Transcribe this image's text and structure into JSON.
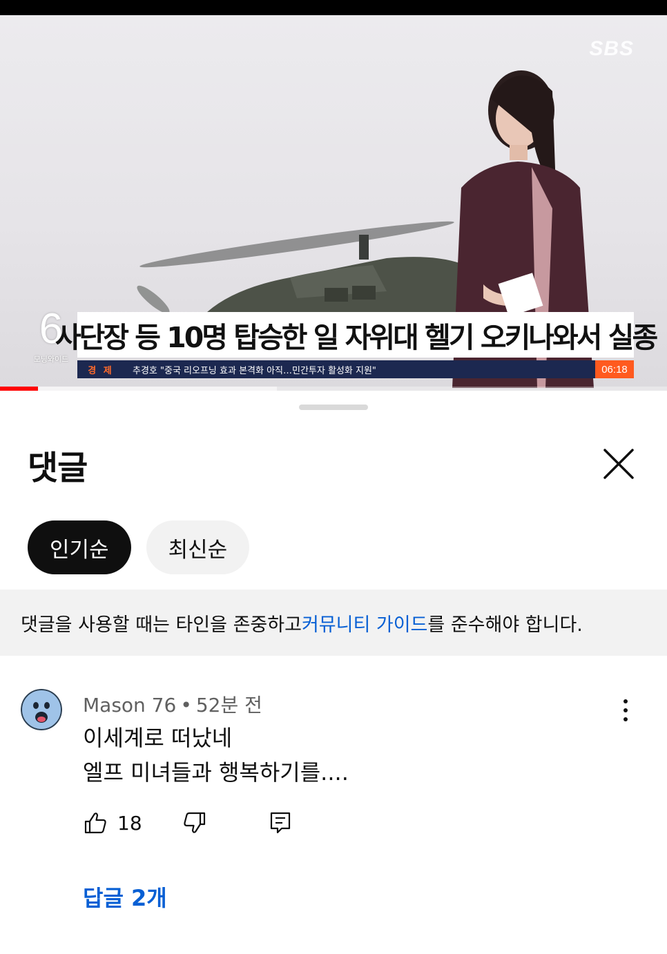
{
  "video": {
    "channel_logo": "SBS",
    "channel_number": "6",
    "program_label": "모닝와이드",
    "headline": "사단장 등 10명 탑승한 일 자위대 헬기 오키나와서 실종",
    "ticker_category": "경 제",
    "ticker_text": "추경호 \"중국 리오프닝 효과 본격화 아직…민간투자 활성화 지원\"",
    "broadcast_time": "06:18",
    "progress_played_fraction": 0.057,
    "progress_buffered_fraction": 0.415
  },
  "comments_panel": {
    "title": "댓글",
    "close_icon": "close-icon",
    "sort_chips": [
      {
        "label": "인기순",
        "active": true
      },
      {
        "label": "최신순",
        "active": false
      }
    ],
    "guide": {
      "before": "댓글을 사용할 때는 타인을 존중하고 ",
      "link": "커뮤니티 가이드",
      "after": "를 준수해야 합니다."
    },
    "comment": {
      "author": "Mason 76",
      "separator": "•",
      "time": "52분 전",
      "lines": [
        "이세계로 떠났네",
        "엘프 미녀들과 행복하기를...."
      ],
      "like_count": "18",
      "replies_label": "답글 2개",
      "icons": [
        "thumbs-up-icon",
        "thumbs-down-icon",
        "reply-icon",
        "more-vertical-icon"
      ]
    }
  },
  "colors": {
    "accent_link": "#065fd4",
    "progress_red": "#ff0000",
    "chip_active_bg": "#0f0f0f",
    "chip_inactive_bg": "#f2f2f2",
    "ticker_bg": "#1c2850",
    "time_badge_bg": "#ff5a1f"
  }
}
